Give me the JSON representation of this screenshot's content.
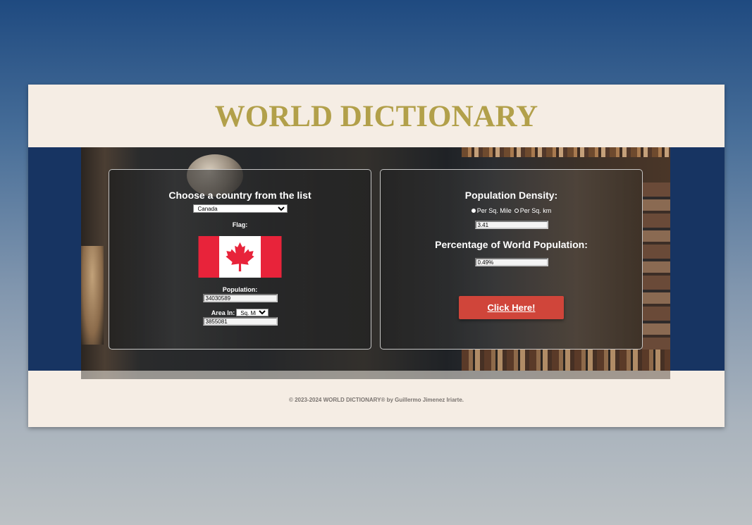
{
  "header": {
    "title": "WORLD DICTIONARY"
  },
  "country_panel": {
    "heading": "Choose a country from the list",
    "selected_country": "Canada",
    "flag_label": "Flag:",
    "population_label": "Population:",
    "population_value": "34030589",
    "area_label": "Area In:",
    "area_unit": "Sq. Miles",
    "area_value": "3855081"
  },
  "stats_panel": {
    "density_heading": "Population Density:",
    "radio_per_sq_mile": "Per Sq. Mile",
    "radio_per_sq_km": "Per Sq. km",
    "density_value": "3.41",
    "percentage_heading": "Percentage of World Population:",
    "percentage_value": "0.49%",
    "button_label": "Click Here!"
  },
  "footer": {
    "copyright": "© 2023-2024 WORLD DICTIONARY® by Guillermo Jimenez Iriarte."
  },
  "colors": {
    "title": "#b2a04a",
    "button": "#d0453a",
    "band": "#173462",
    "page": "#f5ede4"
  },
  "icons": {
    "flag": "canada-flag-icon"
  }
}
